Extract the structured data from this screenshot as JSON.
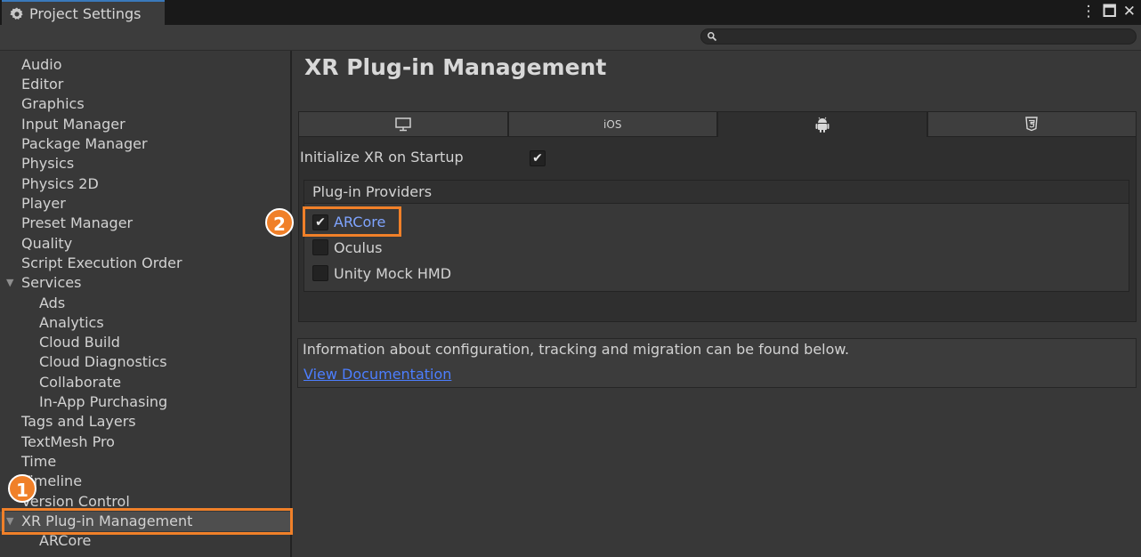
{
  "window": {
    "tab_title": "Project Settings",
    "controls": [
      "more-icon",
      "maximize-icon",
      "close-icon"
    ]
  },
  "search": {
    "placeholder": "",
    "value": ""
  },
  "sidebar": {
    "items": [
      {
        "label": "Audio"
      },
      {
        "label": "Editor"
      },
      {
        "label": "Graphics"
      },
      {
        "label": "Input Manager"
      },
      {
        "label": "Package Manager"
      },
      {
        "label": "Physics"
      },
      {
        "label": "Physics 2D"
      },
      {
        "label": "Player"
      },
      {
        "label": "Preset Manager"
      },
      {
        "label": "Quality"
      },
      {
        "label": "Script Execution Order"
      },
      {
        "label": "Services"
      },
      {
        "label": "Ads"
      },
      {
        "label": "Analytics"
      },
      {
        "label": "Cloud Build"
      },
      {
        "label": "Cloud Diagnostics"
      },
      {
        "label": "Collaborate"
      },
      {
        "label": "In-App Purchasing"
      },
      {
        "label": "Tags and Layers"
      },
      {
        "label": "TextMesh Pro"
      },
      {
        "label": "Time"
      },
      {
        "label": "Timeline"
      },
      {
        "label": "Version Control"
      },
      {
        "label": "XR Plug-in Management"
      },
      {
        "label": "ARCore"
      }
    ],
    "selected": "XR Plug-in Management"
  },
  "main": {
    "title": "XR Plug-in Management",
    "platform_tabs": [
      {
        "icon": "desktop-icon",
        "label": ""
      },
      {
        "icon": "",
        "label": "iOS"
      },
      {
        "icon": "android-icon",
        "label": "",
        "active": true
      },
      {
        "icon": "html5-icon",
        "label": ""
      }
    ],
    "init_label": "Initialize XR on Startup",
    "init_checked": true,
    "providers_header": "Plug-in Providers",
    "providers": [
      {
        "label": "ARCore",
        "checked": true
      },
      {
        "label": "Oculus",
        "checked": false
      },
      {
        "label": "Unity Mock HMD",
        "checked": false
      }
    ],
    "info_text": "Information about configuration, tracking and migration can be found below.",
    "doc_link": "View Documentation"
  },
  "callouts": [
    "1",
    "2"
  ],
  "colors": {
    "accent": "#f08029",
    "link": "#4c7eff",
    "tab_highlight": "#3a79bb"
  }
}
